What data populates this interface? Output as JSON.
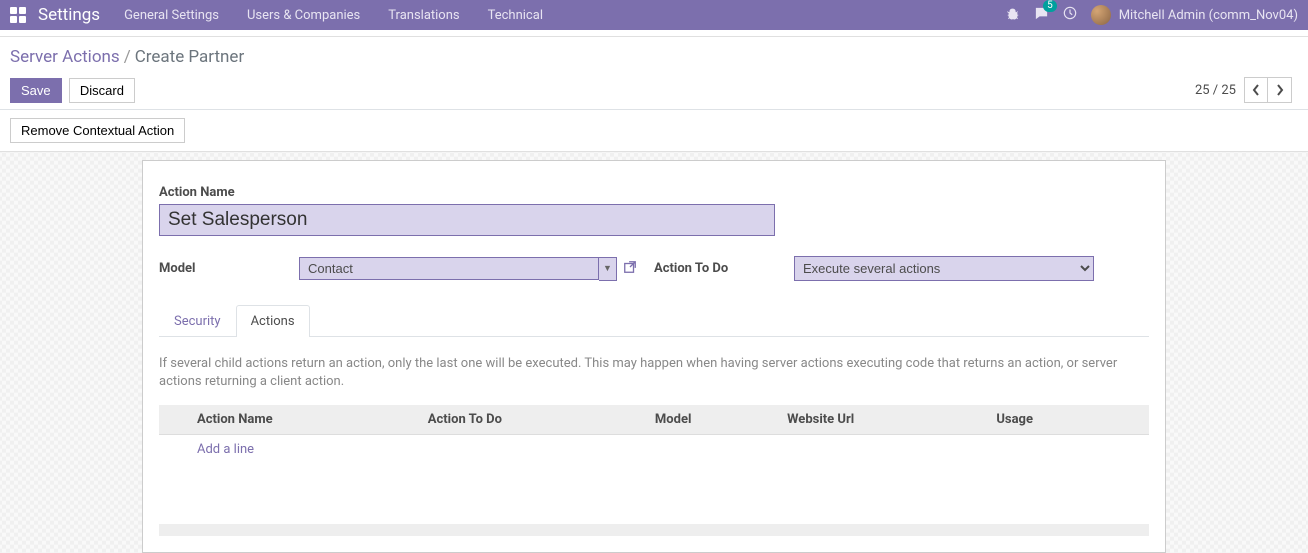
{
  "navbar": {
    "title": "Settings",
    "menu": [
      "General Settings",
      "Users & Companies",
      "Translations",
      "Technical"
    ],
    "messages_badge": "5",
    "user": "Mitchell Admin (comm_Nov04)"
  },
  "breadcrumb": {
    "parent": "Server Actions",
    "current": "Create Partner"
  },
  "buttons": {
    "save": "Save",
    "discard": "Discard",
    "remove_contextual": "Remove Contextual Action"
  },
  "pager": {
    "text": "25 / 25"
  },
  "form": {
    "action_name_label": "Action Name",
    "action_name_value": "Set Salesperson",
    "model_label": "Model",
    "model_value": "Contact",
    "action_to_do_label": "Action To Do",
    "action_to_do_value": "Execute several actions"
  },
  "tabs": {
    "security": "Security",
    "actions": "Actions"
  },
  "help_text": "If several child actions return an action, only the last one will be executed. This may happen when having server actions executing code that returns an action, or server actions returning a client action.",
  "table": {
    "headers": {
      "action_name": "Action Name",
      "action_to_do": "Action To Do",
      "model": "Model",
      "website_url": "Website Url",
      "usage": "Usage"
    },
    "add_line": "Add a line"
  }
}
